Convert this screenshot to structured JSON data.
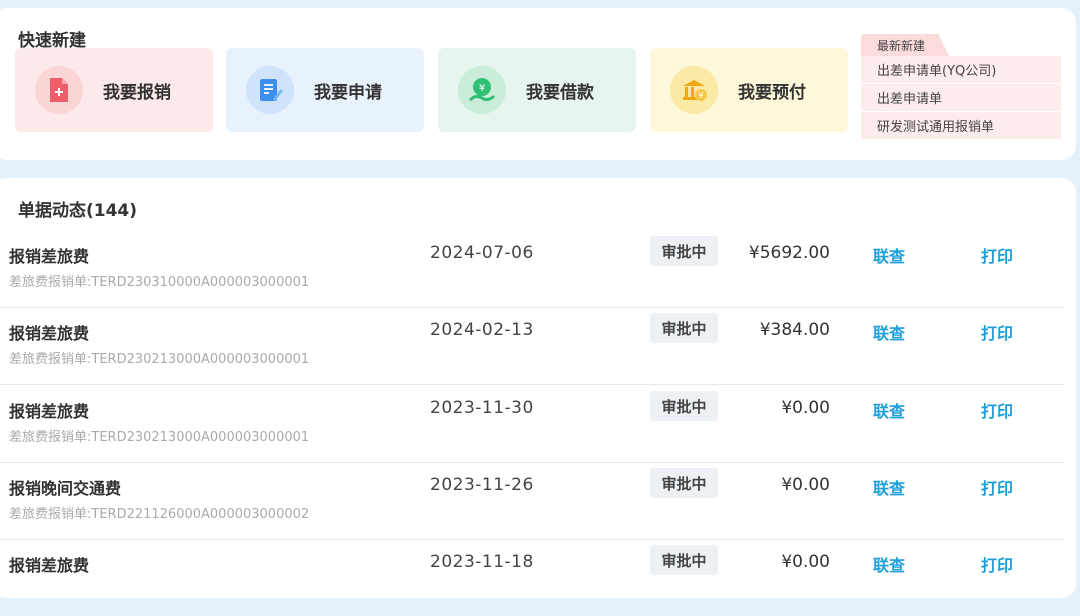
{
  "quick_create": {
    "title": "快速新建",
    "tiles": [
      {
        "label": "我要报销",
        "icon": "document-plus-icon",
        "color": "#ee5d6a"
      },
      {
        "label": "我要申请",
        "icon": "edit-document-icon",
        "color": "#3c8ff0"
      },
      {
        "label": "我要借款",
        "icon": "money-hand-icon",
        "color": "#2fbf75"
      },
      {
        "label": "我要预付",
        "icon": "bank-coin-icon",
        "color": "#f2a712"
      }
    ],
    "recent": {
      "tab_label": "最新新建",
      "items": [
        "出差申请单(YQ公司)",
        "出差申请单",
        "研发测试通用报销单"
      ]
    }
  },
  "documents": {
    "title": "单据动态(144)",
    "query_label": "联查",
    "print_label": "打印",
    "rows": [
      {
        "name": "报销差旅费",
        "number": "差旅费报销单:TERD230310000A000003000001",
        "date": "2024-07-06",
        "status": "审批中",
        "amount": "¥5692.00"
      },
      {
        "name": "报销差旅费",
        "number": "差旅费报销单:TERD230213000A000003000001",
        "date": "2024-02-13",
        "status": "审批中",
        "amount": "¥384.00"
      },
      {
        "name": "报销差旅费",
        "number": "差旅费报销单:TERD230213000A000003000001",
        "date": "2023-11-30",
        "status": "审批中",
        "amount": "¥0.00"
      },
      {
        "name": "报销晚间交通费",
        "number": "差旅费报销单:TERD221126000A000003000002",
        "date": "2023-11-26",
        "status": "审批中",
        "amount": "¥0.00"
      },
      {
        "name": "报销差旅费",
        "number": "",
        "date": "2023-11-18",
        "status": "审批中",
        "amount": "¥0.00"
      }
    ]
  }
}
